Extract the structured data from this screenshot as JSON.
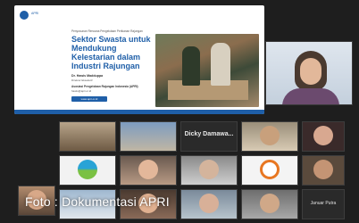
{
  "slide": {
    "webinar_text": "Penyusunan Rencana Pengelolaan Perikanan Rajungan",
    "title": "Sektor Swasta untuk Mendukung Kelestarian dalam Industri Rajungan",
    "speaker_name": "Dr. Hawis Madduppa",
    "speaker_role": "Direktur Eksekutif",
    "organization": "Asosiasi Pengelolaan Rajungan Indonesia (APRI)",
    "email": "hawis@apri.or.id",
    "button_label": "www.apri.or.id"
  },
  "active_speaker": {
    "name": ""
  },
  "thumbnails": {
    "row1": [
      {
        "type": "video",
        "label": ""
      },
      {
        "type": "video",
        "label": ""
      },
      {
        "type": "name",
        "label": "Dicky Damawa..."
      },
      {
        "type": "video",
        "label": ""
      },
      {
        "type": "video",
        "label": ""
      }
    ],
    "row2": [
      {
        "type": "logo",
        "label": ""
      },
      {
        "type": "video",
        "label": ""
      },
      {
        "type": "video",
        "label": ""
      },
      {
        "type": "logo",
        "label": ""
      },
      {
        "type": "video",
        "label": ""
      }
    ],
    "row3": [
      {
        "type": "video",
        "label": ""
      },
      {
        "type": "video",
        "label": ""
      },
      {
        "type": "video",
        "label": ""
      },
      {
        "type": "video",
        "label": ""
      },
      {
        "type": "name",
        "label": "Januar Putra"
      }
    ]
  },
  "caption": "Foto : Dokumentasi APRI",
  "colors": {
    "brand_blue": "#1f5fa8",
    "background": "#1e1e1e"
  }
}
